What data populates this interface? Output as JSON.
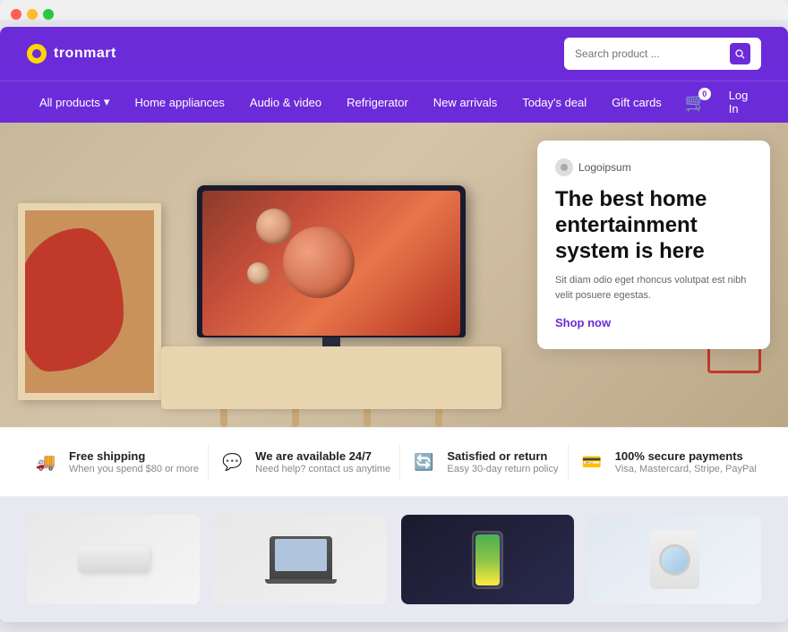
{
  "browser": {
    "dots": [
      "red",
      "yellow",
      "green"
    ]
  },
  "header": {
    "logo_text": "tronmart",
    "search_placeholder": "Search product ...",
    "cart_badge": "0",
    "login_label": "Log In"
  },
  "nav": {
    "items": [
      {
        "label": "All products",
        "has_dropdown": true
      },
      {
        "label": "Home appliances"
      },
      {
        "label": "Audio & video"
      },
      {
        "label": "Refrigerator"
      },
      {
        "label": "New arrivals"
      },
      {
        "label": "Today's deal"
      },
      {
        "label": "Gift cards"
      }
    ]
  },
  "hero": {
    "logo_name": "Logoipsum",
    "title": "The best home entertainment system is here",
    "description": "Sit diam odio eget rhoncus volutpat est nibh velit posuere egestas.",
    "cta_label": "Shop now"
  },
  "features": [
    {
      "icon": "🚚",
      "icon_name": "truck-icon",
      "title": "Free shipping",
      "subtitle": "When you spend $80 or more"
    },
    {
      "icon": "💬",
      "icon_name": "support-icon",
      "title": "We are available 24/7",
      "subtitle": "Need help? contact us anytime"
    },
    {
      "icon": "🔄",
      "icon_name": "return-icon",
      "title": "Satisfied or return",
      "subtitle": "Easy 30-day return policy"
    },
    {
      "icon": "💳",
      "icon_name": "payment-icon",
      "title": "100% secure payments",
      "subtitle": "Visa, Mastercard, Stripe, PayPal"
    }
  ],
  "products": [
    {
      "name": "Air conditioner",
      "type": "ac"
    },
    {
      "name": "Laptop",
      "type": "laptop"
    },
    {
      "name": "Phone",
      "type": "phone"
    },
    {
      "name": "Washing machine",
      "type": "washer"
    }
  ]
}
